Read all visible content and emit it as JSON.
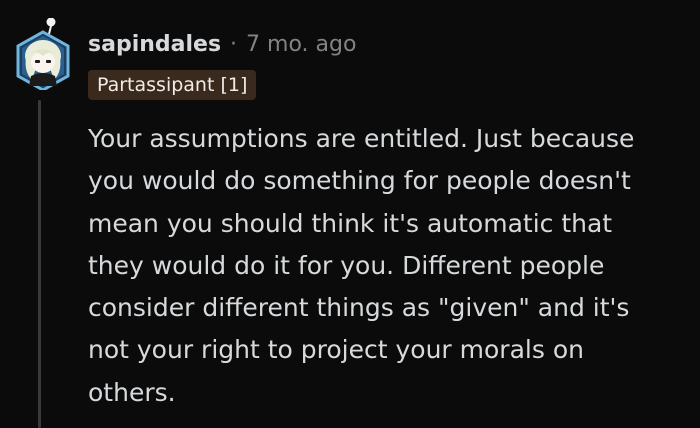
{
  "comment": {
    "username": "sapindales",
    "separator": "·",
    "timestamp": "7 mo. ago",
    "flair": "Partassipant [1]",
    "body_lines": [
      "Your assumptions are entitled. Just because",
      "you would do something for people doesn't",
      "mean you should think it's automatic that",
      "they would do it for you. Different people",
      "consider different things as \"given\" and it's",
      "not your right to project your morals on",
      "others."
    ]
  },
  "colors": {
    "background": "#0b0b0b",
    "text": "#d7dadc",
    "meta": "#818384",
    "flair_bg": "#3a2a1e",
    "avatar_hex": "#6fb6dc"
  },
  "icons": {
    "avatar": "snoo-avatar-icon"
  }
}
